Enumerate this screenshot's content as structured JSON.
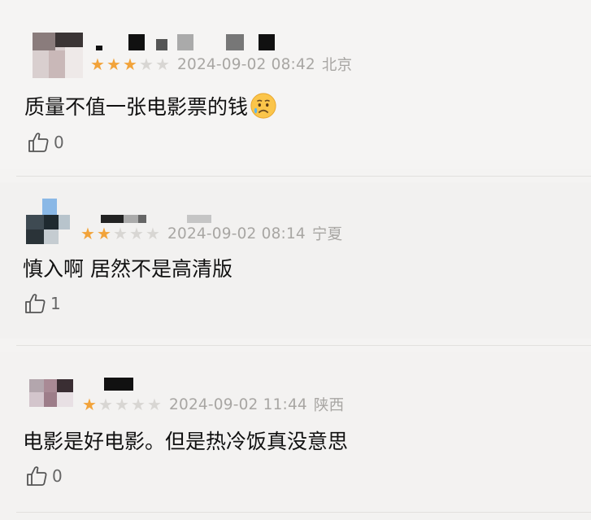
{
  "reviews": [
    {
      "stars": 3,
      "timestamp": "2024-09-02 08:42",
      "location": "北京",
      "text": "质量不值一张电影票的钱",
      "emoji": "sad-tear-face",
      "likes": "0"
    },
    {
      "stars": 2,
      "timestamp": "2024-09-02 08:14",
      "location": "宁夏",
      "text": "慎入啊 居然不是高清版",
      "likes": "1"
    },
    {
      "stars": 1,
      "timestamp": "2024-09-02 11:44",
      "location": "陕西",
      "text": "电影是好电影。但是热冷饭真没意思",
      "likes": "0"
    }
  ],
  "colors": {
    "star_on": "#f2a33a",
    "star_off": "#d8d6d3",
    "meta_text": "#a8a6a3"
  }
}
